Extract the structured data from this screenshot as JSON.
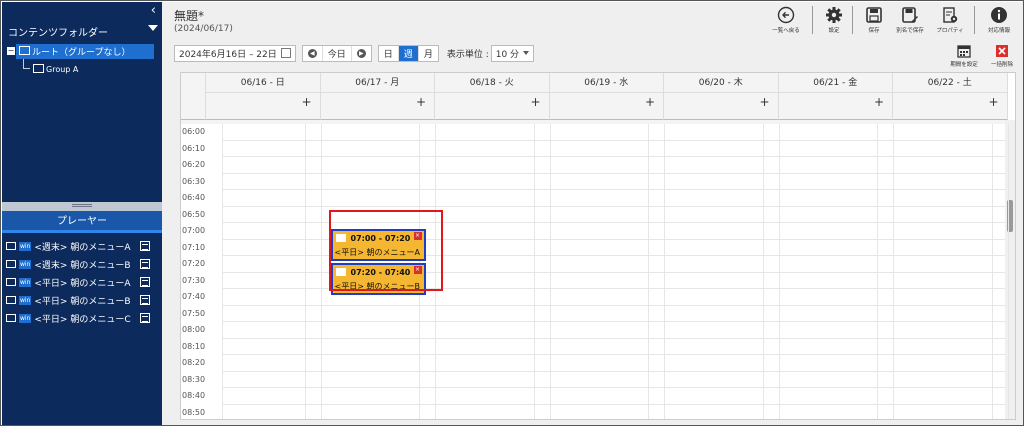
{
  "sidebar": {
    "collapse_icon": "chevron-left-icon",
    "folder_header": "コンテンツフォルダー",
    "tree": {
      "root_label": "ルート（グループなし）",
      "child_label": "Group A"
    },
    "player_header": "プレーヤー",
    "players": [
      {
        "badge": "win",
        "label": "<週末> 朝のメニューA"
      },
      {
        "badge": "win",
        "label": "<週末> 朝のメニューB"
      },
      {
        "badge": "win",
        "label": "<平日> 朝のメニューA"
      },
      {
        "badge": "win",
        "label": "<平日> 朝のメニューB"
      },
      {
        "badge": "win",
        "label": "<平日> 朝のメニューC"
      }
    ]
  },
  "header": {
    "title": "無題*",
    "subtitle": "(2024/06/17)"
  },
  "toolbar": {
    "back_label": "一覧へ戻る",
    "settings_label": "設定",
    "save_label": "保存",
    "save_as_label": "別名で保存",
    "properties_label": "プロパティ",
    "info_label": "対応情報"
  },
  "controls": {
    "date_range": "2024年6月16日 – 22日",
    "today_label": "今日",
    "view_day": "日",
    "view_week": "週",
    "view_month": "月",
    "unit_label": "表示単位 :",
    "unit_value": "10 分",
    "period_label": "期間を設定",
    "delete_all_label": "一括削除"
  },
  "calendar": {
    "days": [
      "06/16 - 日",
      "06/17 - 月",
      "06/18 - 火",
      "06/19 - 水",
      "06/20 - 木",
      "06/21 - 金",
      "06/22 - 土"
    ],
    "add_symbol": "+",
    "times": [
      "06:00",
      "06:10",
      "06:20",
      "06:30",
      "06:40",
      "06:50",
      "07:00",
      "07:10",
      "07:20",
      "07:30",
      "07:40",
      "07:50",
      "08:00",
      "08:10",
      "08:20",
      "08:30",
      "08:40",
      "08:50"
    ],
    "events": [
      {
        "day": 1,
        "time": "07:00 - 07:20",
        "title": "<平日> 朝のメニューA",
        "close": "×"
      },
      {
        "day": 1,
        "time": "07:20 - 07:40",
        "title": "<平日> 朝のメニューB",
        "close": "×"
      }
    ]
  },
  "colors": {
    "sidebar_bg": "#0d2a5c",
    "accent": "#1e6fd0",
    "event_bg": "#f5b731",
    "event_border": "#1f3ec0",
    "highlight": "#e3161b"
  }
}
